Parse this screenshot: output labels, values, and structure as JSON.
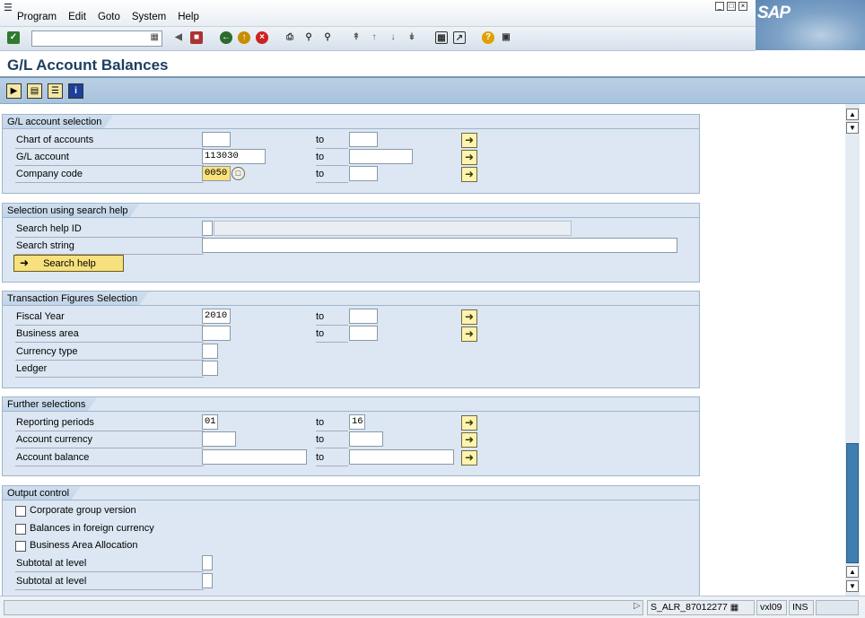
{
  "menu": {
    "items": [
      "Program",
      "Edit",
      "Goto",
      "System",
      "Help"
    ]
  },
  "window": {
    "title": "G/L Account Balances",
    "logo": "SAP"
  },
  "groups": {
    "gl": {
      "title": "G/L account selection",
      "rows": [
        {
          "label": "Chart of accounts",
          "from": "",
          "to_label": "to",
          "to": ""
        },
        {
          "label": "G/L account",
          "from": "113030",
          "to_label": "to",
          "to": ""
        },
        {
          "label": "Company code",
          "from": "0050",
          "to_label": "to",
          "to": ""
        }
      ]
    },
    "search": {
      "title": "Selection using search help",
      "id_label": "Search help ID",
      "string_label": "Search string",
      "button": "Search help"
    },
    "trans": {
      "title": "Transaction Figures Selection",
      "rows": [
        {
          "label": "Fiscal Year",
          "from": "2010",
          "to_label": "to",
          "to": ""
        },
        {
          "label": "Business area",
          "from": "",
          "to_label": "to",
          "to": ""
        },
        {
          "label": "Currency type",
          "from": ""
        },
        {
          "label": "Ledger",
          "from": ""
        }
      ]
    },
    "further": {
      "title": "Further selections",
      "rows": [
        {
          "label": "Reporting periods",
          "from": "01",
          "to_label": "to",
          "to": "16"
        },
        {
          "label": "Account currency",
          "from": "",
          "to_label": "to",
          "to": ""
        },
        {
          "label": "Account balance",
          "from": "",
          "to_label": "to",
          "to": ""
        }
      ]
    },
    "output": {
      "title": "Output control",
      "checks": [
        "Corporate group version",
        "Balances in foreign currency",
        "Business Area Allocation"
      ],
      "subtotals": [
        "Subtotal at level",
        "Subtotal at level"
      ]
    }
  },
  "status": {
    "program": "S_ALR_87012277",
    "server": "vxl09",
    "mode": "INS"
  }
}
